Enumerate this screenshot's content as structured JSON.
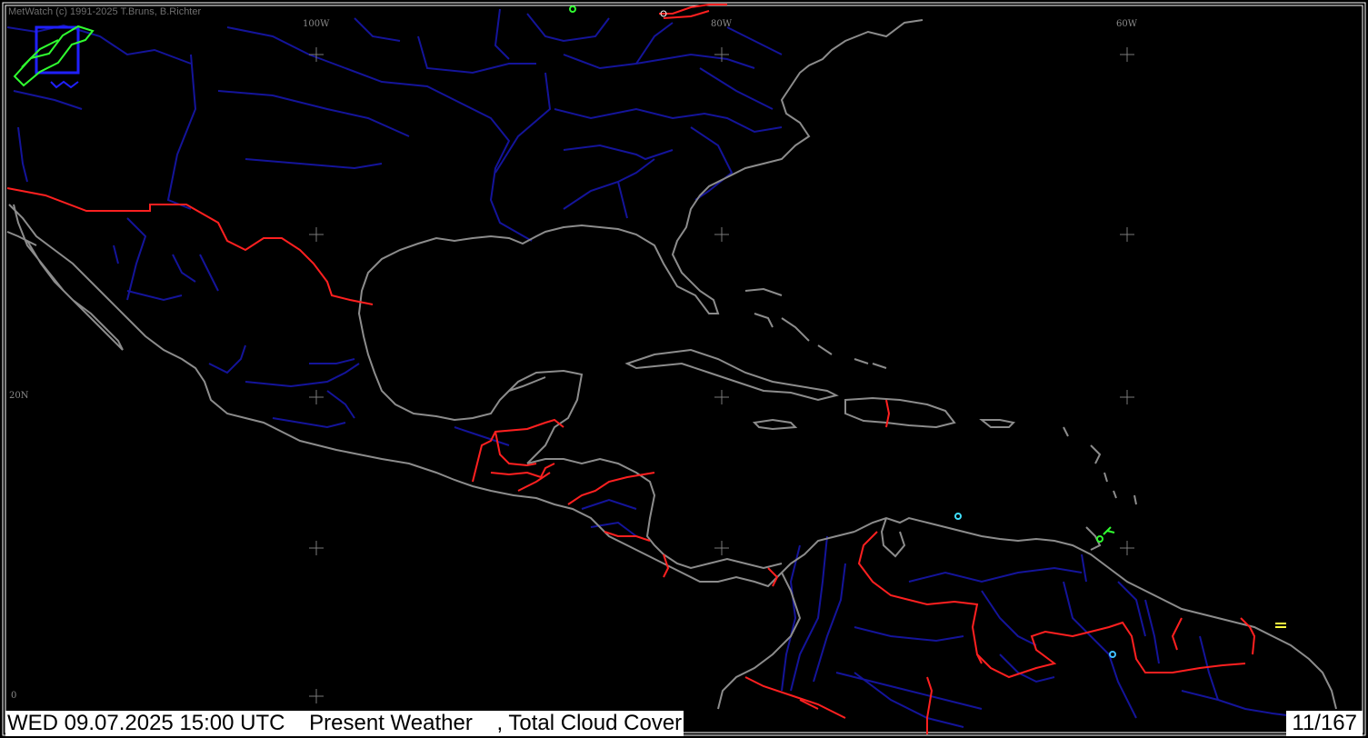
{
  "app": {
    "copyright": "MetWatch  (c) 1991-2025 T.Bruns, B.Richter"
  },
  "axes": {
    "longitude_labels": [
      "100W",
      "80W",
      "60W"
    ],
    "latitude_labels": [
      "20N",
      "0"
    ]
  },
  "status": {
    "datetime": "WED 09.07.2025 15:00 UTC",
    "product": "Present Weather",
    "product2": ", Total Cloud Cover",
    "frame_counter": "11/167"
  },
  "colors": {
    "background": "#000000",
    "coastline": "#8a8a8a",
    "rivers": "#1a1aa0",
    "borders": "#ff2020",
    "weather_symbol_green": "#30ff30",
    "weather_symbol_cyan": "#40e0ff",
    "weather_symbol_yellow": "#ffff40"
  },
  "icons": {
    "logo": "metwatch-logo-icon",
    "grid_marker": "plus-cross-icon"
  }
}
